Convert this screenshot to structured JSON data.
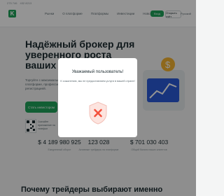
{
  "header": {
    "top_links": [
      "275 746",
      "432 8213"
    ],
    "logo_letter": "K",
    "nav": [
      "Рынки",
      "О платформе",
      "Платформы",
      "Инвестиции",
      "Новости"
    ],
    "enter_label": "Вход",
    "open_label": "Открыть счёт",
    "language": "Русский"
  },
  "hero": {
    "title": "Надёжный брокер для уверенного роста ваших финансов",
    "subtitle": "Торгуйте с максимальной выгодой на современной платформе, профессиональными инструментами и регистрацией.",
    "cta_label": "Стать инвестором",
    "qr_text": "Скачайте приложение на телефон"
  },
  "stats": [
    {
      "value": "$ 4 189 980 925",
      "label": "Ежедневный оборот"
    },
    {
      "value": "123 028",
      "label": "Активные трейдеры на платформе"
    },
    {
      "value": "$ 701 030 403",
      "label": "Общий баланс наших клиентов"
    }
  ],
  "bottom_title": "Почему трейдеры выбирают именно",
  "modal": {
    "title": "Уважаемый пользователь!",
    "text": "К сожалению, мы не предоставляем услуги в вашей стране!",
    "icon": "blocked-shield-icon"
  },
  "colors": {
    "brand": "#1fa35a",
    "modal_icon": "#f3503c",
    "modal_icon_bg": "#fde4df"
  }
}
